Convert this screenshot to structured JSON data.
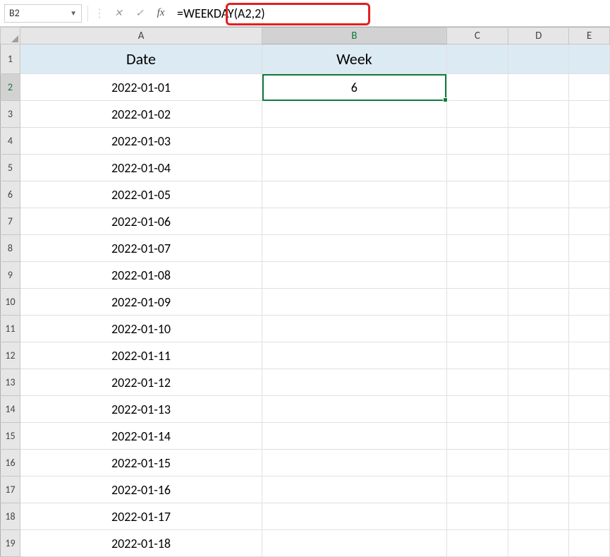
{
  "formula_bar": {
    "name_box": "B2",
    "cancel_tip": "✕",
    "enter_tip": "✓",
    "fx_label": "fx",
    "formula": "=WEEKDAY(A2,2)"
  },
  "columns": [
    "A",
    "B",
    "C",
    "D",
    "E"
  ],
  "row_numbers": [
    "1",
    "2",
    "3",
    "4",
    "5",
    "6",
    "7",
    "8",
    "9",
    "10",
    "11",
    "12",
    "13",
    "14",
    "15",
    "16",
    "17",
    "18",
    "19"
  ],
  "active_cell": "B2",
  "headers": {
    "A": "Date",
    "B": "Week"
  },
  "data": {
    "A": [
      "2022-01-01",
      "2022-01-02",
      "2022-01-03",
      "2022-01-04",
      "2022-01-05",
      "2022-01-06",
      "2022-01-07",
      "2022-01-08",
      "2022-01-09",
      "2022-01-10",
      "2022-01-11",
      "2022-01-12",
      "2022-01-13",
      "2022-01-14",
      "2022-01-15",
      "2022-01-16",
      "2022-01-17",
      "2022-01-18"
    ],
    "B": [
      "6",
      "",
      "",
      "",
      "",
      "",
      "",
      "",
      "",
      "",
      "",
      "",
      "",
      "",
      "",
      "",
      "",
      ""
    ]
  }
}
